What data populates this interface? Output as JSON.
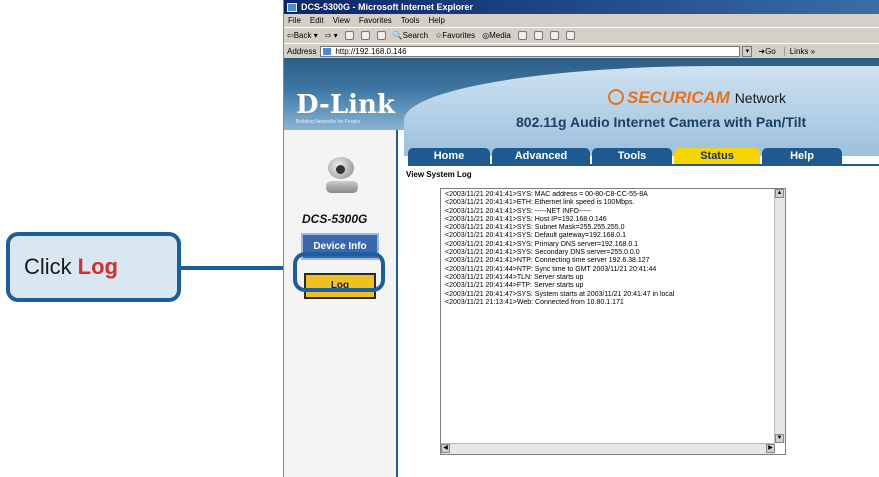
{
  "callout": {
    "prefix": "Click",
    "highlight": "Log"
  },
  "browser": {
    "title": "DCS-5300G - Microsoft Internet Explorer",
    "menu": [
      "File",
      "Edit",
      "View",
      "Favorites",
      "Tools",
      "Help"
    ],
    "toolbar": {
      "back": "Back",
      "search": "Search",
      "favorites": "Favorites",
      "media": "Media"
    },
    "address_label": "Address",
    "address_value": "http://192.168.0.146",
    "go_label": "Go",
    "links_label": "Links"
  },
  "page": {
    "brand": "D-Link",
    "brand_tagline": "Building Networks for People",
    "securicam_a": "SECURI",
    "securicam_b": "CAM",
    "securicam_network": "Network",
    "product_line": "802.11g Audio Internet Camera with Pan/Tilt",
    "model": "DCS-5300G",
    "sidebar": {
      "device_info": "Device Info",
      "log": "Log"
    },
    "tabs": [
      {
        "label": "Home",
        "active": false
      },
      {
        "label": "Advanced",
        "active": false
      },
      {
        "label": "Tools",
        "active": false
      },
      {
        "label": "Status",
        "active": true
      },
      {
        "label": "Help",
        "active": false
      }
    ],
    "section_title": "View System Log",
    "log_lines": [
      "<2003/11/21 20:41:41>SYS: MAC address = 00-80-C8-CC-55-8A",
      "<2003/11/21 20:41:41>ETH: Ethernet link speed is 100Mbps.",
      "<2003/11/21 20:41:41>SYS: -----NET INFO-----",
      "<2003/11/21 20:41:41>SYS: Host IP=192.168.0.146",
      "<2003/11/21 20:41:41>SYS: Subnet Mask=255.255.255.0",
      "<2003/11/21 20:41:41>SYS: Default gateway=192.168.0.1",
      "<2003/11/21 20:41:41>SYS: Primary DNS server=192.168.0.1",
      "<2003/11/21 20:41:41>SYS: Secondary DNS server=255.0.0.0",
      "<2003/11/21 20:41:41>NTP: Connecting time server 192.6.38.127",
      "<2003/11/21 20:41:44>NTP: Sync time to GMT 2003/11/21 20:41:44",
      "<2003/11/21 20:41:44>TLN: Server starts up",
      "<2003/11/21 20:41:44>FTP: Server starts up",
      "<2003/11/21 20:41:47>SYS: System starts at 2003/11/21 20:41:47 in local",
      "<2003/11/21 21:13:41>Web: Connected from 10.80.1.171"
    ]
  },
  "colors": {
    "callout_border": "#1d5f9e",
    "tab": "#1f5a8f",
    "tab_active": "#f5d400",
    "log_button": "#f0c020"
  }
}
